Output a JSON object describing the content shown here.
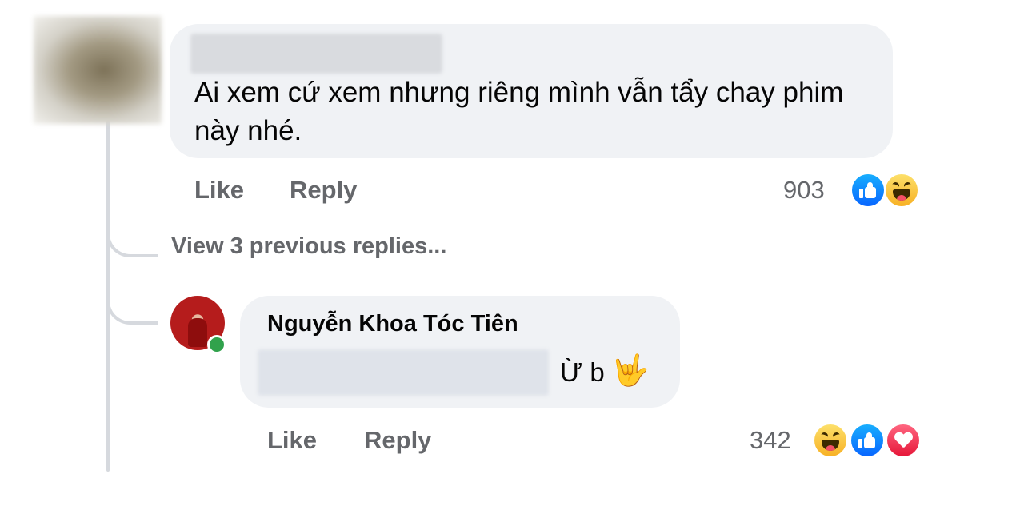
{
  "thread": {
    "top_comment": {
      "author_name": "",
      "text": "Ai xem cứ xem nhưng riêng mình vẫn tẩy chay phim này nhé.",
      "actions": {
        "like_label": "Like",
        "reply_label": "Reply"
      },
      "reactions": {
        "count": "903",
        "types": [
          "like-icon",
          "haha-icon"
        ]
      }
    },
    "view_previous_replies_label": "View 3 previous replies...",
    "reply": {
      "author_name": "Nguyễn Khoa Tóc Tiên",
      "author_online": true,
      "text": "Ừ b",
      "emoji": "🤟",
      "actions": {
        "like_label": "Like",
        "reply_label": "Reply"
      },
      "reactions": {
        "count": "342",
        "types": [
          "haha-icon",
          "like-icon",
          "love-icon"
        ]
      }
    }
  },
  "colors": {
    "bubble_bg": "#f0f2f5",
    "secondary_text": "#65676b",
    "like_blue": "#0866ff",
    "haha_yellow": "#f7b125",
    "love_red": "#e61739",
    "online_green": "#31a24c"
  }
}
